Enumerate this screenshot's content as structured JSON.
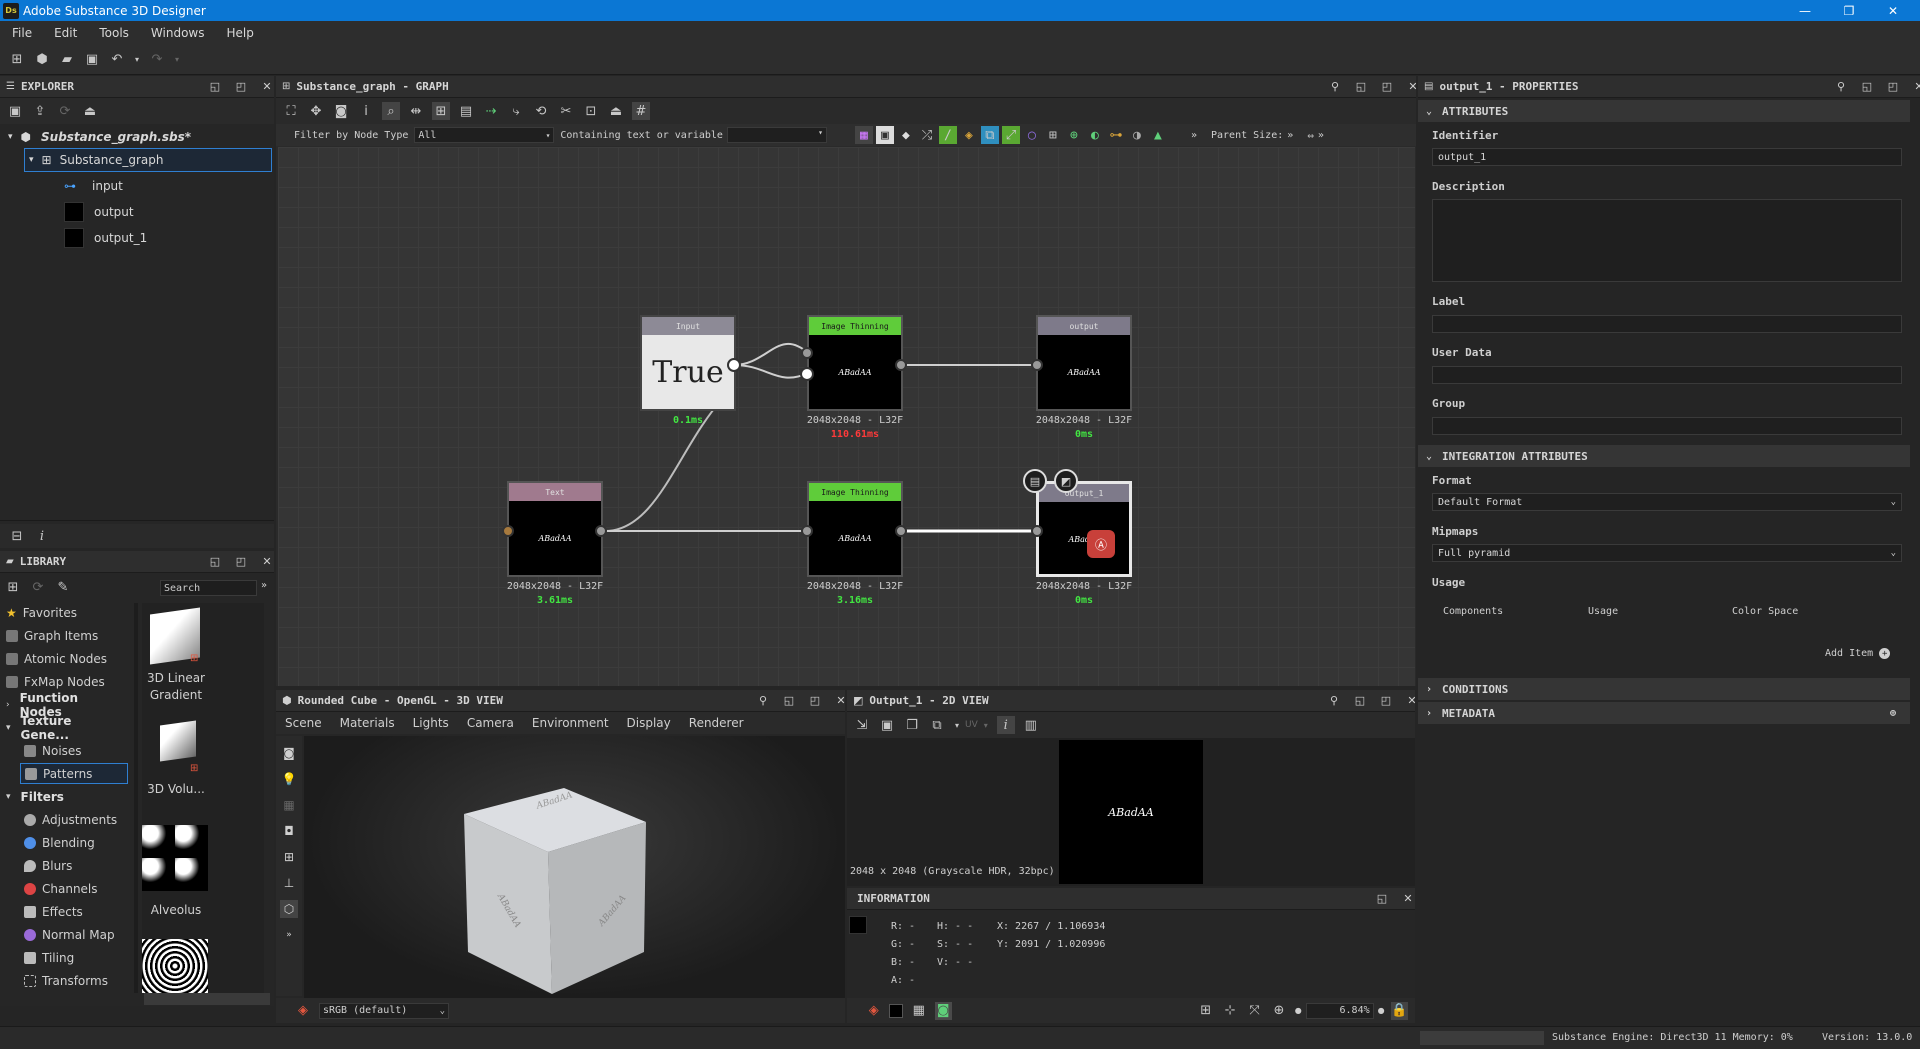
{
  "app": {
    "logo": "Ds",
    "title": "Adobe Substance 3D Designer",
    "version": "Version: 13.0.0"
  },
  "window_controls": {
    "minimize": "—",
    "restore": "❐",
    "close": "✕"
  },
  "menu": [
    "File",
    "Edit",
    "Tools",
    "Windows",
    "Help"
  ],
  "explorer": {
    "title": "EXPLORER",
    "package": "Substance_graph.sbs*",
    "graph": "Substance_graph",
    "items": [
      "input",
      "output",
      "output_1"
    ]
  },
  "library": {
    "title": "LIBRARY",
    "search_placeholder": "Search",
    "categories": [
      "Favorites",
      "Graph Items",
      "Atomic Nodes",
      "FxMap Nodes",
      "Function Nodes",
      "Texture Gene...",
      "Noises",
      "Patterns",
      "Filters",
      "Adjustments",
      "Blending",
      "Blurs",
      "Channels",
      "Effects",
      "Normal Map",
      "Tiling",
      "Transforms"
    ],
    "thumbs": [
      "3D Linear Gradient",
      "3D Volu...",
      "Alveolus"
    ]
  },
  "graph": {
    "title": "Substance_graph - GRAPH",
    "filter_label": "Filter by Node Type",
    "filter_value": "All",
    "containing_label": "Containing text or variable",
    "parent_size": "Parent Size:",
    "nodes": {
      "input": {
        "header": "Input",
        "body": "True",
        "time": "0.1ms"
      },
      "thin1": {
        "header": "Image Thinning",
        "body": "ABadAA",
        "size": "2048x2048 - L32F",
        "time": "110.61ms"
      },
      "output": {
        "header": "output",
        "body": "ABadAA",
        "size": "2048x2048 - L32F",
        "time": "0ms"
      },
      "text": {
        "header": "Text",
        "body": "ABadAA",
        "size": "2048x2048 - L32F",
        "time": "3.61ms"
      },
      "thin2": {
        "header": "Image Thinning",
        "body": "ABadAA",
        "size": "2048x2048 - L32F",
        "time": "3.16ms"
      },
      "output1": {
        "header": "output_1",
        "body": "ABadAA",
        "size": "2048x2048 - L32F",
        "time": "0ms"
      }
    }
  },
  "view3d": {
    "title": "Rounded Cube - OpenGL - 3D VIEW",
    "tabs": [
      "Scene",
      "Materials",
      "Lights",
      "Camera",
      "Environment",
      "Display",
      "Renderer"
    ],
    "colorspace": "sRGB (default)",
    "cube_text": "ABadAA"
  },
  "view2d": {
    "title": "Output_1 - 2D VIEW",
    "image_text": "ABadAA",
    "image_info": "2048 x 2048 (Grayscale HDR, 32bpc)",
    "uv_label": "UV",
    "zoom": "6.84%"
  },
  "information": {
    "title": "INFORMATION",
    "rows": [
      {
        "c": "R: -",
        "h": "H: - -",
        "xy": "X:  2267 / 1.106934"
      },
      {
        "c": "G: -",
        "h": "S: - -",
        "xy": "Y:  2091 / 1.020996"
      },
      {
        "c": "B: -",
        "h": "V: - -",
        "xy": ""
      },
      {
        "c": "A: -",
        "h": "",
        "xy": ""
      }
    ]
  },
  "properties": {
    "title": "output_1 - PROPERTIES",
    "section_attributes": "ATTRIBUTES",
    "identifier_label": "Identifier",
    "identifier_value": "output_1",
    "description_label": "Description",
    "label_label": "Label",
    "userdata_label": "User Data",
    "group_label": "Group",
    "section_integration": "INTEGRATION ATTRIBUTES",
    "format_label": "Format",
    "format_value": "Default Format",
    "mipmaps_label": "Mipmaps",
    "mipmaps_value": "Full pyramid",
    "usage_label": "Usage",
    "usage_cols": [
      "Components",
      "Usage",
      "Color Space"
    ],
    "add_item": "Add Item",
    "section_conditions": "CONDITIONS",
    "section_metadata": "METADATA"
  },
  "status": {
    "engine": "Substance Engine: Direct3D 11  Memory: 0%"
  }
}
